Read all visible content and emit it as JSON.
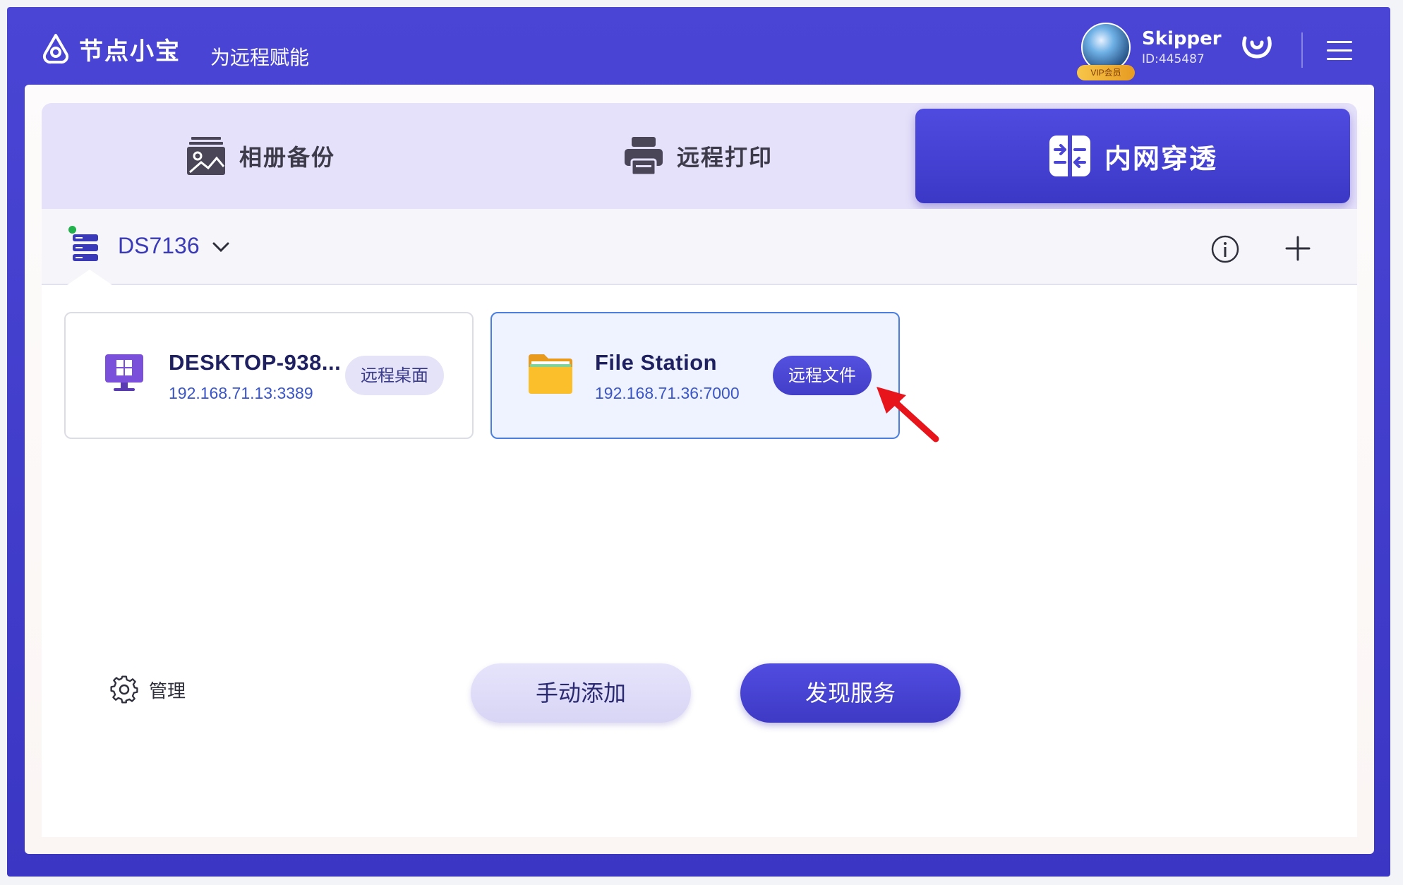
{
  "app": {
    "name": "节点小宝",
    "slogan": "为远程赋能"
  },
  "user": {
    "name": "Skipper",
    "id": "ID:445487",
    "badge": "VIP会员"
  },
  "tabs": [
    {
      "label": "相册备份",
      "icon": "photo-album-icon",
      "active": false
    },
    {
      "label": "远程打印",
      "icon": "printer-icon",
      "active": false
    },
    {
      "label": "内网穿透",
      "icon": "tunnel-icon",
      "active": true
    }
  ],
  "device": {
    "name": "DS7136",
    "status": "online"
  },
  "services": [
    {
      "title": "DESKTOP-938...",
      "address": "192.168.71.13:3389",
      "action": "远程桌面",
      "icon": "windows-desktop-icon",
      "selected": false
    },
    {
      "title": "File Station",
      "address": "192.168.71.36:7000",
      "action": "远程文件",
      "icon": "folder-icon",
      "selected": true
    }
  ],
  "footer": {
    "manage_label": "管理",
    "add_label": "手动添加",
    "discover_label": "发现服务"
  },
  "colors": {
    "primary": "#4a45d4",
    "tab_bg": "#e6e1fa",
    "online": "#22b14c",
    "arrow": "#e8141b"
  }
}
